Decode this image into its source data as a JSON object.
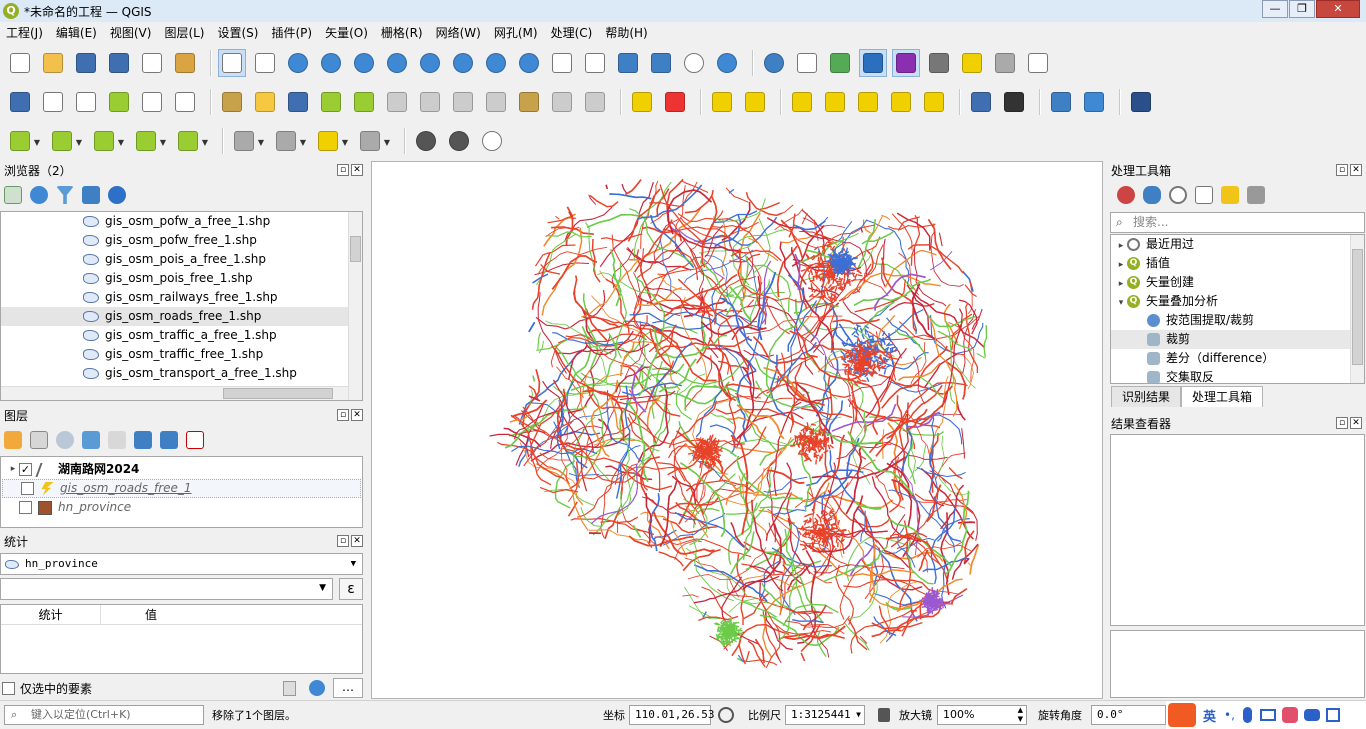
{
  "window": {
    "title": "*未命名的工程 — QGIS",
    "minimize": "—",
    "restore": "❐",
    "close": "✕"
  },
  "menu": [
    "工程(J)",
    "编辑(E)",
    "视图(V)",
    "图层(L)",
    "设置(S)",
    "插件(P)",
    "矢量(O)",
    "栅格(R)",
    "网络(W)",
    "网孔(M)",
    "处理(C)",
    "帮助(H)"
  ],
  "toolbar1": {
    "icons": [
      "new-project-icon",
      "open-project-icon",
      "save-project-icon",
      "save-as-icon",
      "print-layout-icon",
      "style-manager-icon",
      "sep",
      "pan-icon",
      "pan-to-selection-icon",
      "zoom-in-icon",
      "zoom-out-icon",
      "zoom-full-icon",
      "zoom-to-selection-icon",
      "zoom-to-layer-icon",
      "zoom-native-icon",
      "zoom-last-icon",
      "zoom-next-icon",
      "new-map-view-icon",
      "new-3d-view-icon",
      "bookmark-new-icon",
      "bookmarks-icon",
      "temporal-controller-icon",
      "refresh-icon",
      "sep",
      "identify-icon",
      "attribute-table-icon",
      "field-calculator-icon",
      "processing-toolbox-icon",
      "statistics-icon",
      "measure-icon",
      "map-tips-icon",
      "select-feature-icon",
      "annotation-text-icon"
    ],
    "active": [
      "pan-icon",
      "processing-toolbox-icon",
      "statistics-icon"
    ]
  },
  "toolbar2": {
    "icons": [
      "data-source-manager-icon",
      "new-geopackage-icon",
      "new-shapefile-icon",
      "digitize-icon",
      "new-temporary-layer-icon",
      "new-virtual-layer-icon",
      "sep",
      "current-edits-icon",
      "toggle-editing-icon",
      "save-edits-icon",
      "vertex-tool-icon",
      "add-feature-icon",
      "modify-attributes-icon",
      "delete-selected-icon",
      "cut-features-icon",
      "copy-features-icon",
      "paste-features-icon",
      "undo-icon",
      "redo-icon",
      "sep",
      "label-toolbar-icon",
      "diagram-icon",
      "sep",
      "label-pin-icon",
      "label-highlight-icon",
      "sep",
      "label-move-icon",
      "label-show-icon",
      "label-rotate-icon",
      "label-change-icon",
      "label-properties-icon",
      "sep",
      "georeferencer-icon",
      "gps-icon",
      "sep",
      "python-console-icon",
      "location-icon",
      "sep",
      "help-icon"
    ]
  },
  "toolbar3": {
    "icons": [
      "digitize-line-icon",
      "digitize-polygon-icon",
      "digitize-circle-icon",
      "digitize-rectangle-icon",
      "digitize-regular-polygon-icon",
      "sep",
      "select-area-icon",
      "select-by-value-icon",
      "deselect-icon",
      "select-by-location-icon",
      "sep",
      "globe-icon",
      "settings-icon",
      "search-icon"
    ]
  },
  "browser": {
    "title": "浏览器（2）",
    "files": [
      "gis_osm_pofw_a_free_1.shp",
      "gis_osm_pofw_free_1.shp",
      "gis_osm_pois_a_free_1.shp",
      "gis_osm_pois_free_1.shp",
      "gis_osm_railways_free_1.shp",
      "gis_osm_roads_free_1.shp",
      "gis_osm_traffic_a_free_1.shp",
      "gis_osm_traffic_free_1.shp",
      "gis_osm_transport_a_free_1.shp"
    ],
    "selected_index": 5
  },
  "layers": {
    "title": "图层",
    "items": [
      {
        "name": "湖南路网2024",
        "checked": true,
        "bold": true,
        "expandable": true
      },
      {
        "name": "gis_osm_roads_free_1",
        "checked": false,
        "italic": true,
        "selected": true
      },
      {
        "name": "hn_province",
        "checked": false,
        "italic": true,
        "color": "#a0522d"
      }
    ]
  },
  "stats": {
    "title": "统计",
    "layer": "hn_province",
    "field": "",
    "expr_btn": "ε",
    "col_stat": "统计",
    "col_value": "值",
    "selected_only": "仅选中的要素",
    "more": "…"
  },
  "toolbox": {
    "title": "处理工具箱",
    "search_placeholder": "搜索...",
    "tree": [
      {
        "label": "最近用过",
        "level": 0,
        "icon": "clock-icon",
        "arrow": "▸"
      },
      {
        "label": "插值",
        "level": 0,
        "icon": "q",
        "arrow": "▸"
      },
      {
        "label": "矢量创建",
        "level": 0,
        "icon": "q",
        "arrow": "▸"
      },
      {
        "label": "矢量叠加分析",
        "level": 0,
        "icon": "q",
        "arrow": "▾"
      },
      {
        "label": "按范围提取/裁剪",
        "level": 1,
        "icon": "gear-icon"
      },
      {
        "label": "裁剪",
        "level": 1,
        "icon": "clip-icon",
        "selected": true
      },
      {
        "label": "差分（difference）",
        "level": 1,
        "icon": "difference-icon"
      },
      {
        "label": "交集取反",
        "level": 1,
        "icon": "symdiff-icon"
      }
    ],
    "tab_identify": "识别结果",
    "tab_toolbox": "处理工具箱"
  },
  "results": {
    "title": "结果查看器"
  },
  "status": {
    "locator_placeholder": "键入以定位(Ctrl+K)",
    "message": "移除了1个图层。",
    "coord_label": "坐标",
    "coord": "110.01,26.53",
    "scale_label": "比例尺",
    "scale": "1:3125441",
    "magnifier_label": "放大镜",
    "magnifier": "100%",
    "rotation_label": "旋转角度",
    "rotation": "0.0°",
    "ime": "英"
  },
  "map_colors": [
    "#e8432a",
    "#3c6fd6",
    "#6ccb49",
    "#c8283c",
    "#f08a2c",
    "#9b59d0"
  ]
}
